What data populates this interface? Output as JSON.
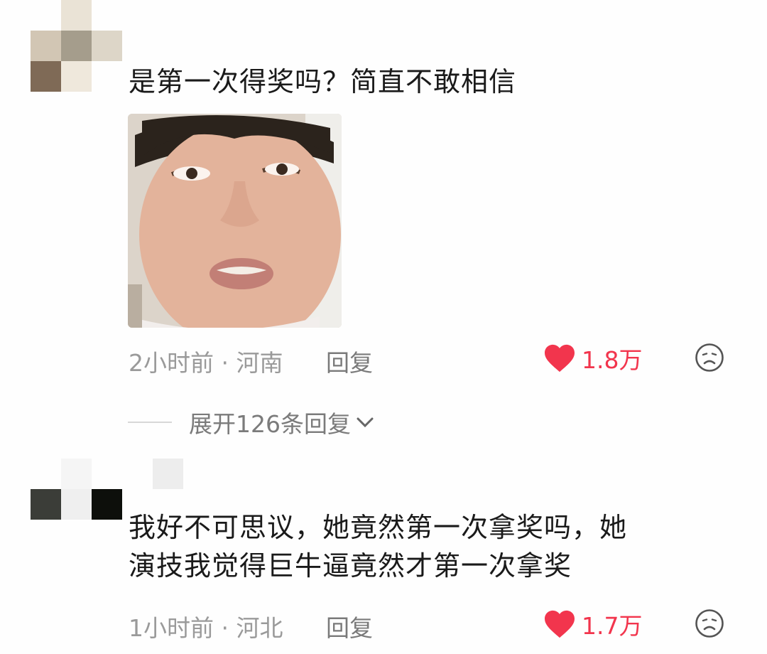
{
  "comments": [
    {
      "avatar_colors": [
        "#fefefe",
        "#eae3d6",
        "#fefefe",
        "#d2c6b4",
        "#a59d8c",
        "#ddd6c8",
        "#7f6a56",
        "#efe8dc",
        "#fefefe"
      ],
      "text": "是第一次得奖吗？简直不敢相信",
      "image": "meme-face-image",
      "time": "2小时前",
      "location": "河南",
      "reply_label": "回复",
      "likes": "1.8万",
      "expand_label": "展开126条回复"
    },
    {
      "avatar_colors": [
        "#fefefe",
        "#f5f5f5",
        "#fefefe",
        "#fefefe",
        "#ededed",
        "#3b3d38",
        "#efefef",
        "#0d0f0b",
        "#fefefe",
        "#fefefe"
      ],
      "text_lines": [
        "我好不可思议，她竟然第一次拿奖吗，她",
        "演技我觉得巨牛逼竟然才第一次拿奖"
      ],
      "time": "1小时前",
      "location": "河北",
      "reply_label": "回复",
      "likes": "1.7万"
    }
  ],
  "colors": {
    "like": "#f2354d",
    "meta": "#9a9a9a",
    "text": "#1a1a1a"
  },
  "icons": {
    "like": "heart-icon",
    "dislike": "sad-face-icon",
    "expand": "chevron-down-icon"
  }
}
